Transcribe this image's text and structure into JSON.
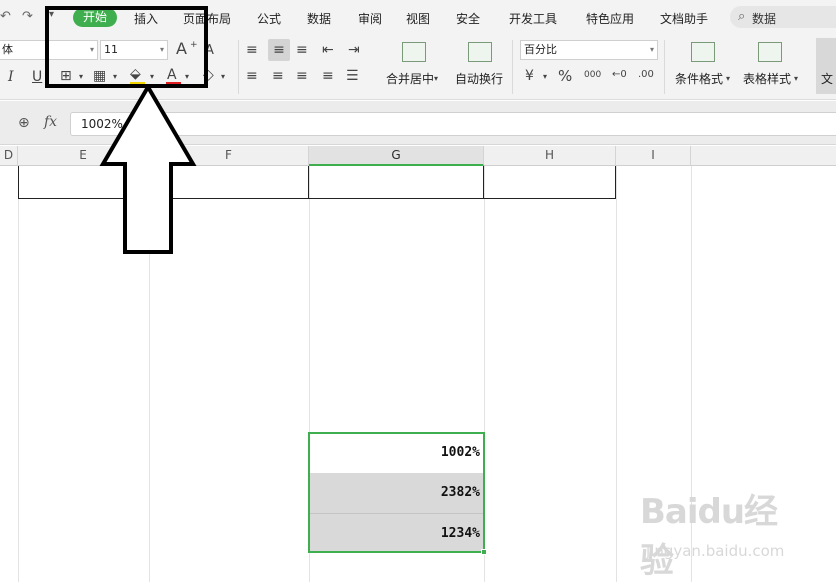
{
  "quick_access": {
    "undo_icon": "undo-icon",
    "redo_icon": "redo-icon",
    "more_icon": "chevron-down-icon"
  },
  "menu": {
    "tabs": [
      {
        "label": "开始",
        "active": true
      },
      {
        "label": "插入"
      },
      {
        "label": "页面布局"
      },
      {
        "label": "公式"
      },
      {
        "label": "数据"
      },
      {
        "label": "审阅"
      },
      {
        "label": "视图"
      },
      {
        "label": "安全"
      },
      {
        "label": "开发工具"
      },
      {
        "label": "特色应用"
      },
      {
        "label": "文档助手"
      }
    ],
    "search_label": "数据",
    "accent_color": "#3fae4f"
  },
  "ribbon": {
    "font_name": "体",
    "font_size": "11",
    "increase_font_label": "A",
    "decrease_font_label": "A",
    "italic_label": "I",
    "underline_label": "U",
    "font_color_label": "A",
    "merge_center_label": "合并居中",
    "wrap_text_label": "自动换行",
    "number_format": "百分比",
    "percent_label": "%",
    "thousands_label": "000",
    "conditional_format_label": "条件格式",
    "table_style_label": "表格样式",
    "text_partial_label": "文"
  },
  "formula_bar": {
    "fx_label": "fx",
    "value": "1002%"
  },
  "columns": [
    "D",
    "E",
    "F",
    "G",
    "H",
    "I"
  ],
  "selected_column": "G",
  "cells": [
    {
      "value": "1002%",
      "shaded": false
    },
    {
      "value": "2382%",
      "shaded": true
    },
    {
      "value": "1234%",
      "shaded": true
    }
  ],
  "watermark": {
    "main": "Baidu经验",
    "sub": "jingyan.baidu.com"
  }
}
